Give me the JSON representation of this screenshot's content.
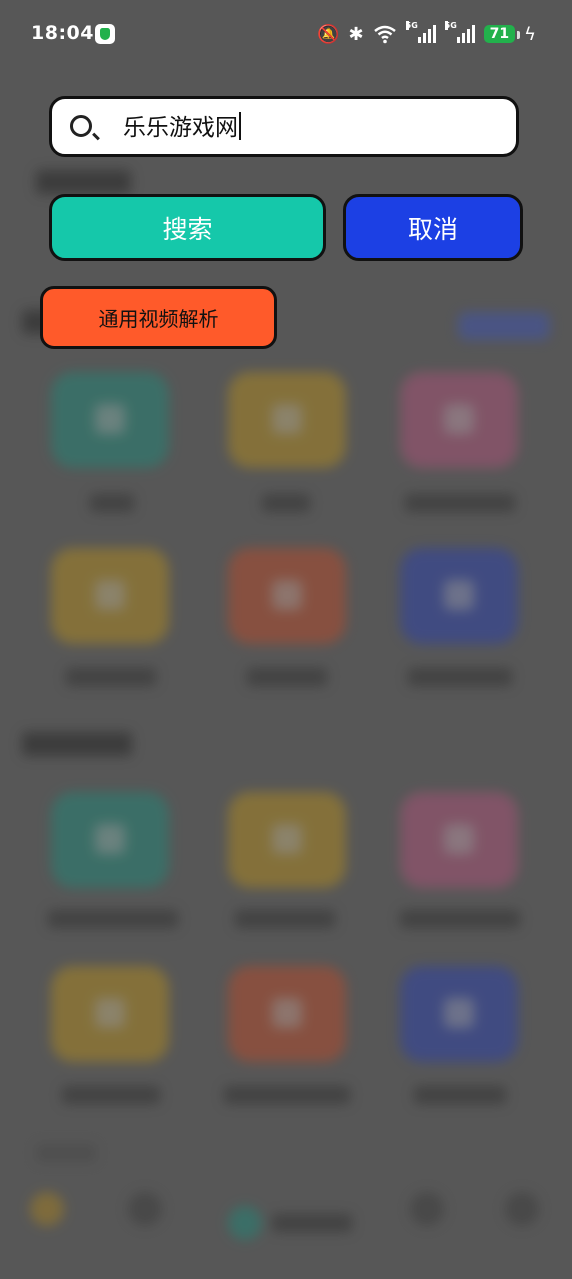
{
  "status_bar": {
    "time": "18:04",
    "network_label_1": "5G",
    "network_label_2": "5G",
    "battery_level": "71"
  },
  "search": {
    "value": "乐乐游戏网"
  },
  "buttons": {
    "search_label": "搜索",
    "cancel_label": "取消",
    "parse_label": "通用视频解析"
  },
  "colors": {
    "search_button": "#15c8aa",
    "cancel_button": "#1c40e4",
    "parse_button": "#ff5a2a",
    "battery": "#22b14c"
  },
  "icons": {
    "search": "search-icon",
    "mute": "bell-off-icon",
    "bluetooth": "bluetooth-icon",
    "wifi": "wifi-icon"
  }
}
